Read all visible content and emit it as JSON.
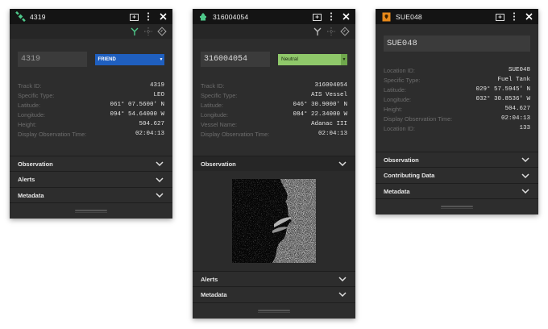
{
  "panels": [
    {
      "title": "4319",
      "icon": "satellite-icon",
      "id_value": "4319",
      "affiliation": {
        "label": "FRIEND",
        "color": "#1f5fbf"
      },
      "properties": [
        {
          "key": "Track ID:",
          "value": "4319"
        },
        {
          "key": "Specific Type:",
          "value": "LEO"
        },
        {
          "key": "Latitude:",
          "value": "061° 07.5600' N"
        },
        {
          "key": "Longitude:",
          "value": "094° 54.64000 W"
        },
        {
          "key": "Height:",
          "value": "504.627"
        },
        {
          "key": "Display Observation Time:",
          "value": "02:04:13"
        }
      ],
      "sections": [
        "Observation",
        "Alerts",
        "Metadata"
      ]
    },
    {
      "title": "316004054",
      "icon": "vessel-icon",
      "id_value": "316004054",
      "affiliation": {
        "label": "Neutral",
        "color": "#8fc86a"
      },
      "properties": [
        {
          "key": "Track ID:",
          "value": "316004054"
        },
        {
          "key": "Specific Type:",
          "value": "AIS Vessel"
        },
        {
          "key": "Latitude:",
          "value": "046° 30.9000' N"
        },
        {
          "key": "Longitude:",
          "value": "084° 22.34000 W"
        },
        {
          "key": "Vessel Name:",
          "value": "Adanac III"
        },
        {
          "key": "Display Observation Time:",
          "value": "02:04:13"
        }
      ],
      "open_section": "Observation",
      "sections": [
        "Alerts",
        "Metadata"
      ]
    },
    {
      "title": "SUE048",
      "icon": "location-pin-icon",
      "id_value": "SUE048",
      "properties": [
        {
          "key": "Location ID:",
          "value": "SUE048"
        },
        {
          "key": "Specific Type:",
          "value": "Fuel Tank"
        },
        {
          "key": "Latitude:",
          "value": "029° 57.5945' N"
        },
        {
          "key": "Longitude:",
          "value": "032° 30.8536' W"
        },
        {
          "key": "Height:",
          "value": "504.627"
        },
        {
          "key": "Display Observation Time:",
          "value": "02:04:13"
        },
        {
          "key": "Location ID:",
          "value": "133"
        }
      ],
      "sections": [
        "Observation",
        "Contributing Data",
        "Metadata"
      ]
    }
  ],
  "colors": {
    "panel_bg": "#2d2d2d",
    "titlebar_bg": "#141414",
    "accent_green": "#8fc86a",
    "accent_blue": "#1f5fbf",
    "icon_orange": "#e8891a",
    "icon_green": "#4ec88a"
  }
}
